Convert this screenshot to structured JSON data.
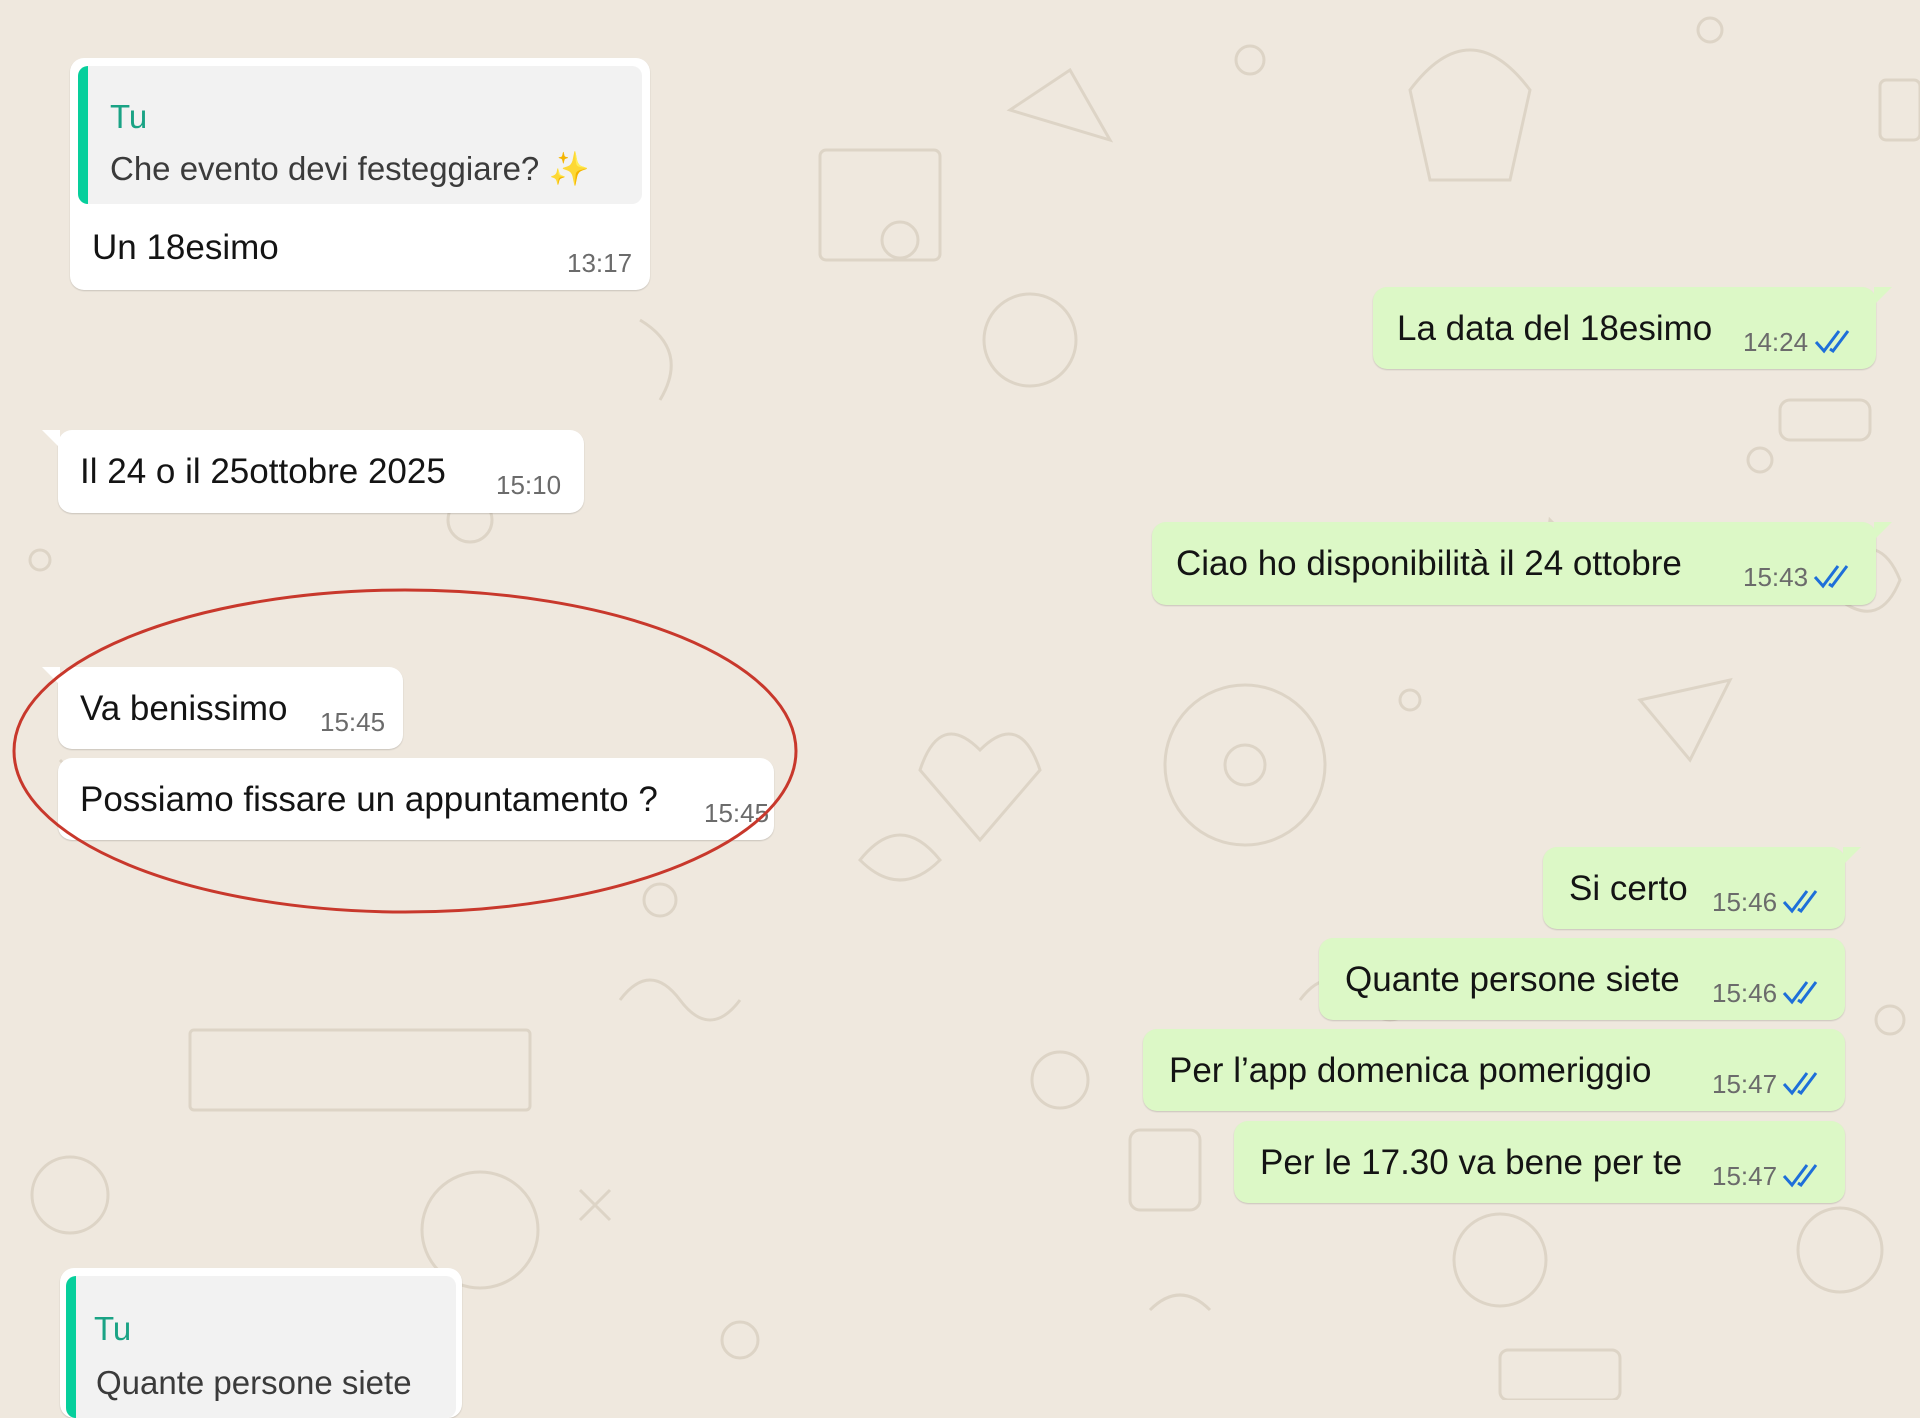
{
  "background_color": "#efe8de",
  "accent_colors": {
    "incoming_bubble": "#ffffff",
    "outgoing_bubble": "#dcf8c6",
    "quote_bar": "#06cf9c",
    "quote_author": "#1aa385",
    "read_ticks": "#1e6fd9",
    "highlight_ring": "#c8382c"
  },
  "messages": [
    {
      "direction": "incoming",
      "quote": {
        "author": "Tu",
        "text": "Che evento devi festeggiare?",
        "emoji": "✨"
      },
      "text": "Un 18esimo",
      "time": "13:17"
    },
    {
      "direction": "outgoing",
      "text": "La data del 18esimo",
      "time": "14:24",
      "status": "read",
      "status_icon": "double-check-icon"
    },
    {
      "direction": "incoming",
      "text": "Il 24 o il 25ottobre 2025",
      "time": "15:10"
    },
    {
      "direction": "outgoing",
      "text": "Ciao ho disponibilità il 24 ottobre",
      "time": "15:43",
      "status": "read",
      "status_icon": "double-check-icon"
    },
    {
      "direction": "incoming",
      "text": "Va benissimo",
      "time": "15:45",
      "highlighted": true
    },
    {
      "direction": "incoming",
      "text": "Possiamo fissare un appuntamento ?",
      "time": "15:45",
      "highlighted": true
    },
    {
      "direction": "outgoing",
      "text": "Si certo",
      "time": "15:46",
      "status": "read",
      "status_icon": "double-check-icon"
    },
    {
      "direction": "outgoing",
      "text": "Quante persone siete",
      "time": "15:46",
      "status": "read",
      "status_icon": "double-check-icon"
    },
    {
      "direction": "outgoing",
      "text": "Per l’app  domenica pomeriggio",
      "time": "15:47",
      "status": "read",
      "status_icon": "double-check-icon"
    },
    {
      "direction": "outgoing",
      "text": "Per le 17.30 va bene per te",
      "time": "15:47",
      "status": "read",
      "status_icon": "double-check-icon"
    },
    {
      "direction": "incoming",
      "quote": {
        "author": "Tu",
        "text": "Quante persone siete"
      },
      "partial": true
    }
  ]
}
